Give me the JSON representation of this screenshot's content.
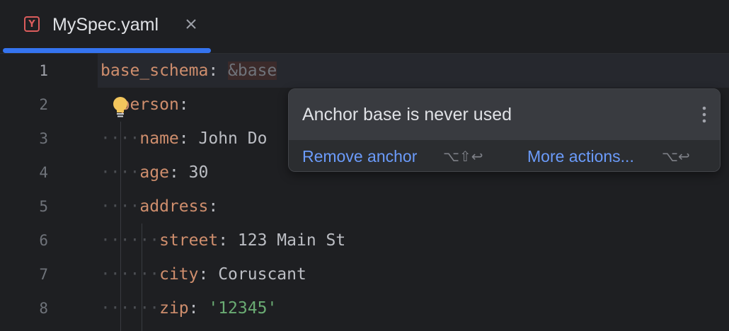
{
  "tab": {
    "title": "MySpec.yaml",
    "icon_letter": "Y",
    "icon": "yaml-file-icon",
    "close_icon": "close-icon"
  },
  "editor": {
    "line_numbers": [
      "1",
      "2",
      "3",
      "4",
      "5",
      "6",
      "7",
      "8"
    ],
    "current_line": "1",
    "lines": [
      {
        "indent": "",
        "key": "base_schema",
        "colon": ":",
        "value": "",
        "anchor": "&base"
      },
      {
        "indent": "",
        "key": "person",
        "colon": ":",
        "value": ""
      },
      {
        "indent": "····",
        "key": "name",
        "colon": ":",
        "value": "John Do"
      },
      {
        "indent": "····",
        "key": "age",
        "colon": ":",
        "value": "30"
      },
      {
        "indent": "····",
        "key": "address",
        "colon": ":",
        "value": ""
      },
      {
        "indent": "······",
        "key": "street",
        "colon": ":",
        "value": "123 Main St"
      },
      {
        "indent": "······",
        "key": "city",
        "colon": ":",
        "value": "Coruscant"
      },
      {
        "indent": "······",
        "key": "zip",
        "colon": ":",
        "value": "'12345'"
      }
    ],
    "intention_icon": "lightbulb-icon"
  },
  "popup": {
    "message": "Anchor base is never used",
    "menu_icon": "more-vertical-icon",
    "actions": [
      {
        "label": "Remove anchor",
        "shortcut": "⌥⇧↩"
      },
      {
        "label": "More actions...",
        "shortcut": "⌥↩"
      }
    ]
  },
  "colors": {
    "background": "#1e1f22",
    "accent": "#3574f0",
    "key": "#cf8e6d",
    "string": "#6aab73",
    "link": "#6b9bfa"
  }
}
